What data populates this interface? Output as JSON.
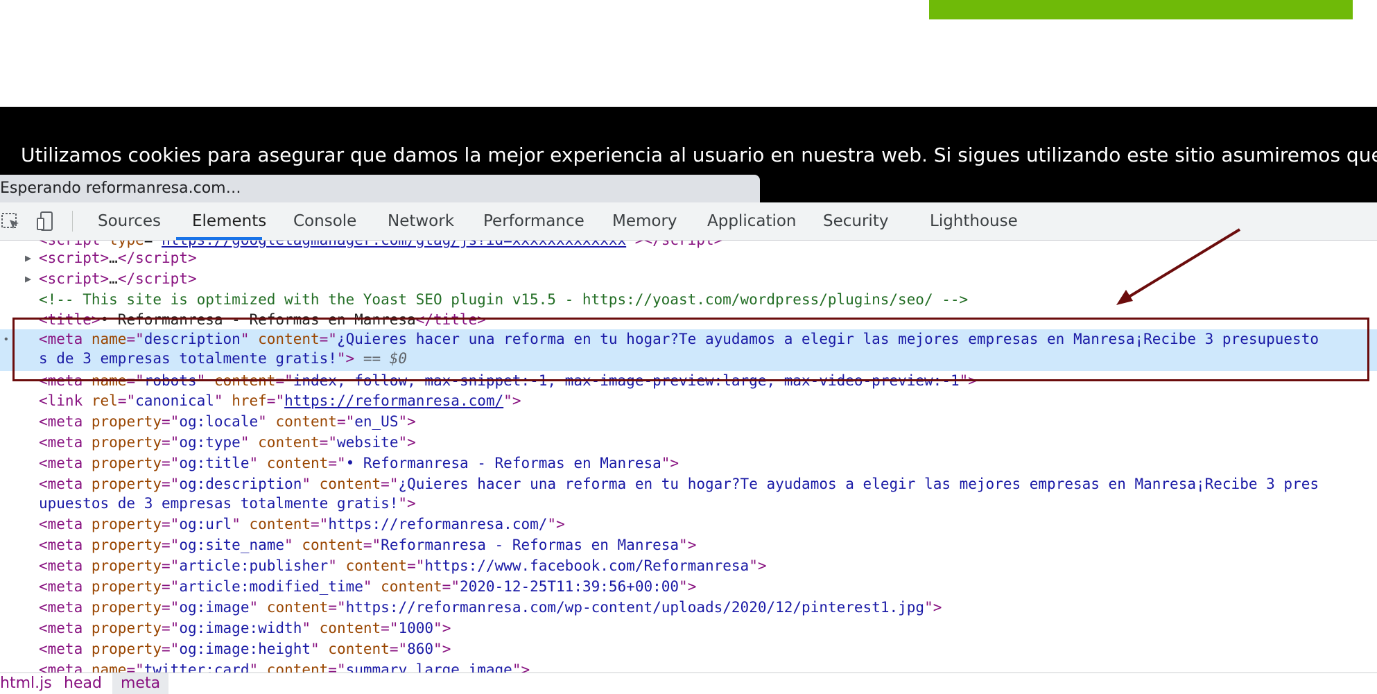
{
  "cookie_banner": {
    "text": "Utilizamos cookies para asegurar que damos la mejor experiencia al usuario en nuestra web. Si sigues utilizando este sitio asumiremos que esta"
  },
  "status": {
    "text": "Esperando reformanresa.com…"
  },
  "devtools": {
    "tabs": [
      "Sources",
      "Elements",
      "Console",
      "Network",
      "Performance",
      "Memory",
      "Application",
      "Security",
      "Lighthouse"
    ],
    "active_tab": "Elements",
    "breadcrumbs": [
      "html.js",
      "head",
      "meta"
    ],
    "selected_suffix": "== $0"
  },
  "code": {
    "comment": "<!-- This site is optimized with the Yoast SEO plugin v15.5 - https://yoast.com/wordpress/plugins/seo/ -->",
    "title_text": "• Reformanresa - Reformas en Manresa",
    "description_line1": "¿Quieres hacer una reforma en tu hogar?Te ayudamos a elegir las mejores empresas en Manresa¡Recibe 3 presupuesto",
    "description_line2": "s de 3 empresas totalmente gratis!",
    "robots_content": "index, follow, max-snippet:-1, max-image-preview:large, max-video-preview:-1",
    "canonical_href": "https://reformanresa.com/",
    "og_locale": "en_US",
    "og_type": "website",
    "og_title": "• Reformanresa - Reformas en Manresa",
    "og_description_line1": "¿Quieres hacer una reforma en tu hogar?Te ayudamos a elegir las mejores empresas en Manresa¡Recibe 3 pres",
    "og_description_line2": "upuestos de 3 empresas totalmente gratis!",
    "og_url": "https://reformanresa.com/",
    "og_site_name": "Reformanresa - Reformas en Manresa",
    "article_publisher": "https://www.facebook.com/Reformanresa",
    "article_modified_time": "2020-12-25T11:39:56+00:00",
    "og_image": "https://reformanresa.com/wp-content/uploads/2020/12/pinterest1.jpg",
    "og_image_width": "1000",
    "og_image_height": "860",
    "twitter_card": "summary_large_image"
  },
  "colors": {
    "accent_green": "#6fba08",
    "annotation_red": "#6b0c0c",
    "selection_blue": "#cfe8fc"
  }
}
